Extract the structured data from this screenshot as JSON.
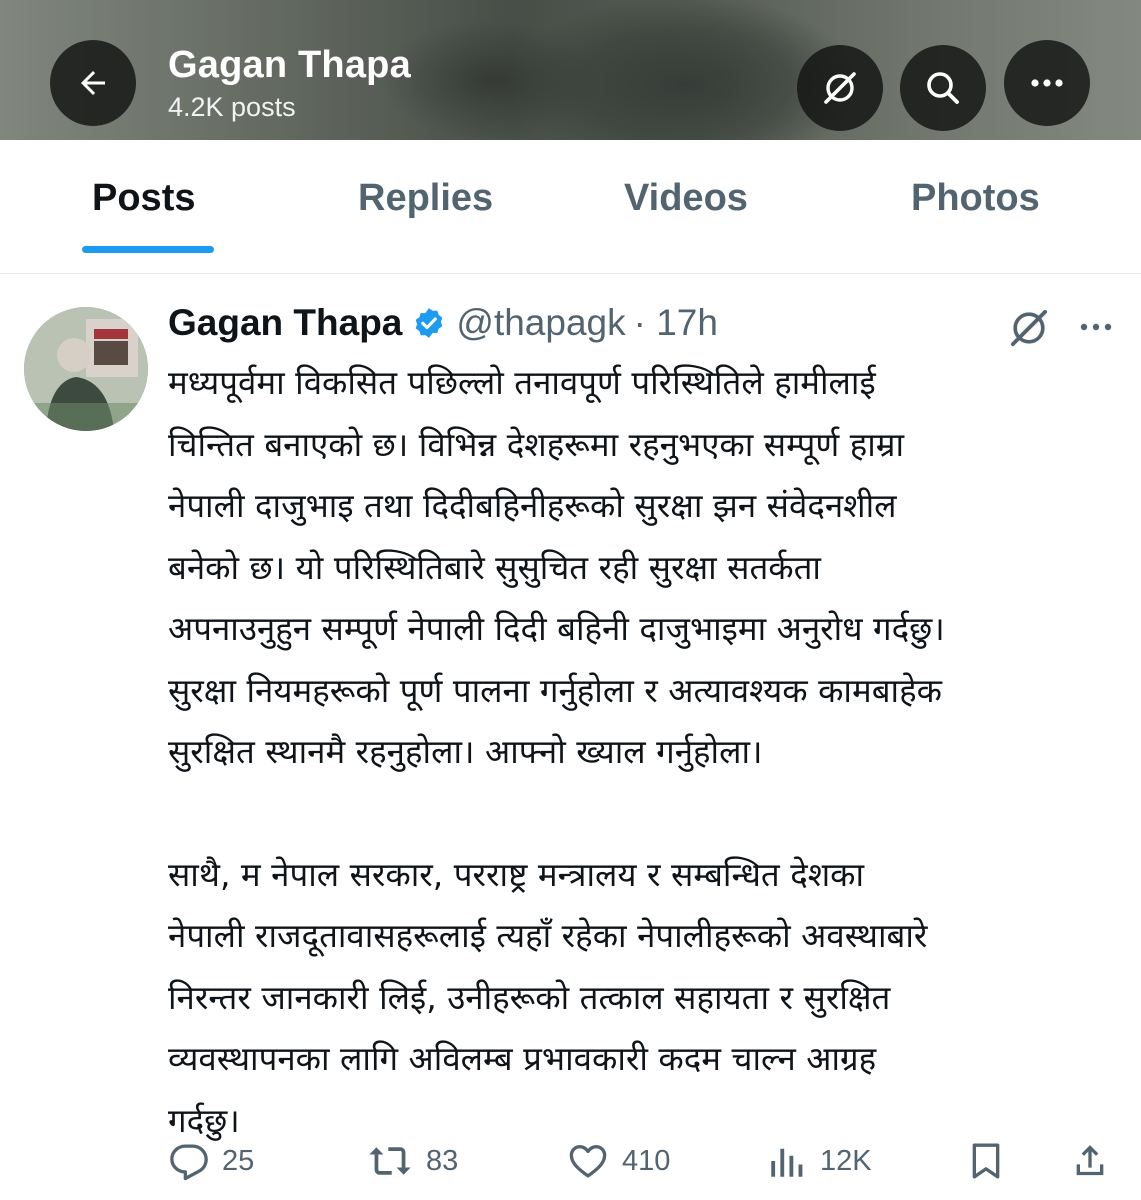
{
  "header": {
    "name": "Gagan Thapa",
    "post_count": "4.2K posts",
    "back_icon": "arrow-left-icon",
    "buttons": [
      "grok-icon",
      "search-icon",
      "more-icon"
    ]
  },
  "tabs": [
    {
      "label": "Posts",
      "active": true
    },
    {
      "label": "Replies",
      "active": false
    },
    {
      "label": "Videos",
      "active": false
    },
    {
      "label": "Photos",
      "active": false
    }
  ],
  "tweet": {
    "author_name": "Gagan Thapa",
    "handle": "@thapagk",
    "time_ago": "· 17h",
    "verified": true,
    "lines_para1": [
      "मध्यपूर्वमा विकसित पछिल्लो तनावपूर्ण परिस्थितिले हामीलाई",
      "चिन्तित बनाएको छ। विभिन्न देशहरूमा रहनुभएका सम्पूर्ण हाम्रा",
      "नेपाली दाजुभाइ तथा दिदीबहिनीहरूको सुरक्षा झन संवेदनशील",
      "बनेको छ। यो परिस्थितिबारे सुसुचित रही सुरक्षा सतर्कता",
      "अपनाउनुहुन सम्पूर्ण नेपाली दिदी बहिनी दाजुभाइमा अनुरोध गर्दछु।",
      "सुरक्षा नियमहरूको पूर्ण पालना गर्नुहोला र अत्यावश्यक कामबाहेक",
      "सुरक्षित स्थानमै रहनुहोला। आफ्नो ख्याल गर्नुहोला।"
    ],
    "lines_para2": [
      "साथै, म नेपाल सरकार, परराष्ट्र मन्त्रालय र सम्बन्धित देशका",
      "नेपाली राजदूतावासहरूलाई त्यहाँ रहेका नेपालीहरूको अवस्थाबारे",
      "निरन्तर जानकारी लिई, उनीहरूको तत्काल सहायता र सुरक्षित",
      "व्यवस्थापनका लागि अविलम्ब प्रभावकारी कदम चाल्न आग्रह",
      "गर्दछु।"
    ],
    "actions": {
      "replies": "25",
      "reposts": "83",
      "likes": "410",
      "views": "12K"
    }
  },
  "colors": {
    "accent": "#1d9bf0",
    "text": "#0f1419",
    "muted": "#536471"
  }
}
